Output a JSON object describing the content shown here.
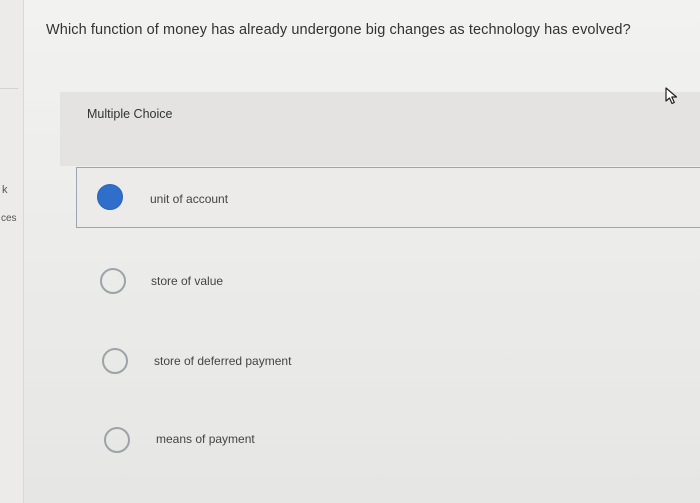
{
  "sidebar": {
    "fragment_top": "k",
    "fragment_bottom": "ces"
  },
  "question": {
    "text": "Which function of money has already undergone big changes as technology has evolved?"
  },
  "question_type": {
    "label": "Multiple Choice"
  },
  "options": [
    {
      "label": "unit of account",
      "selected": true
    },
    {
      "label": "store of value",
      "selected": false
    },
    {
      "label": "store of deferred payment",
      "selected": false
    },
    {
      "label": "means of payment",
      "selected": false
    }
  ],
  "colors": {
    "selected_radio": "#2f6fcb",
    "radio_outline": "#9ea3a8",
    "selected_border": "#9aa6b2"
  },
  "icons": {
    "cursor": "mouse-pointer-icon"
  }
}
